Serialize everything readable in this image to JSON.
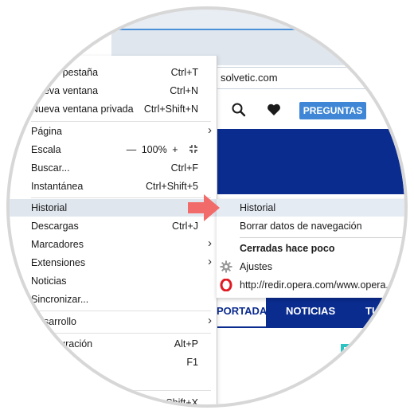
{
  "browser": {
    "address": "solvetic.com",
    "site_button": "PREGUNTAS",
    "nav_tabs": [
      "PORTADA",
      "NOTICIAS",
      "TU"
    ]
  },
  "menu": {
    "items": [
      {
        "label": "Nueva pestaña",
        "shortcut": "Ctrl+T"
      },
      {
        "label": "Nueva ventana",
        "shortcut": "Ctrl+N"
      },
      {
        "label": "Nueva ventana privada",
        "shortcut": "Ctrl+Shift+N"
      },
      {
        "label": "Página"
      },
      {
        "label": "Escala",
        "zoom": "100%"
      },
      {
        "label": "Buscar...",
        "shortcut": "Ctrl+F"
      },
      {
        "label": "Instantánea",
        "shortcut": "Ctrl+Shift+5"
      },
      {
        "label": "Historial"
      },
      {
        "label": "Descargas",
        "shortcut": "Ctrl+J"
      },
      {
        "label": "Marcadores"
      },
      {
        "label": "Extensiones"
      },
      {
        "label": "Noticias"
      },
      {
        "label": "Sincronizar..."
      },
      {
        "label": "Desarrollo"
      },
      {
        "label": "Configuración",
        "shortcut": "Alt+P"
      },
      {
        "label": "",
        "shortcut": "F1"
      },
      {
        "label": "",
        "shortcut": "Ctrl+Shift+X"
      }
    ],
    "zoom_minus": "—",
    "zoom_plus": "+"
  },
  "submenu": {
    "items": [
      {
        "label": "Historial"
      },
      {
        "label": "Borrar datos de navegación"
      },
      {
        "label": "Cerradas hace poco"
      },
      {
        "label": "Ajustes"
      },
      {
        "label": "http://redir.opera.com/www.opera.com"
      }
    ]
  },
  "colors": {
    "accent": "#3f87d6",
    "site_blue": "#0b2c8f",
    "highlight": "#dfe6ee",
    "pointer_arrow": "#f26b6b",
    "opera_red": "#e01a22"
  },
  "icons": {
    "search": "search-icon",
    "heart": "heart-icon",
    "fullscreen": "fullscreen-icon",
    "gear": "gear-icon",
    "opera": "opera-logo-icon",
    "arrow": "pointer-arrow-icon"
  }
}
